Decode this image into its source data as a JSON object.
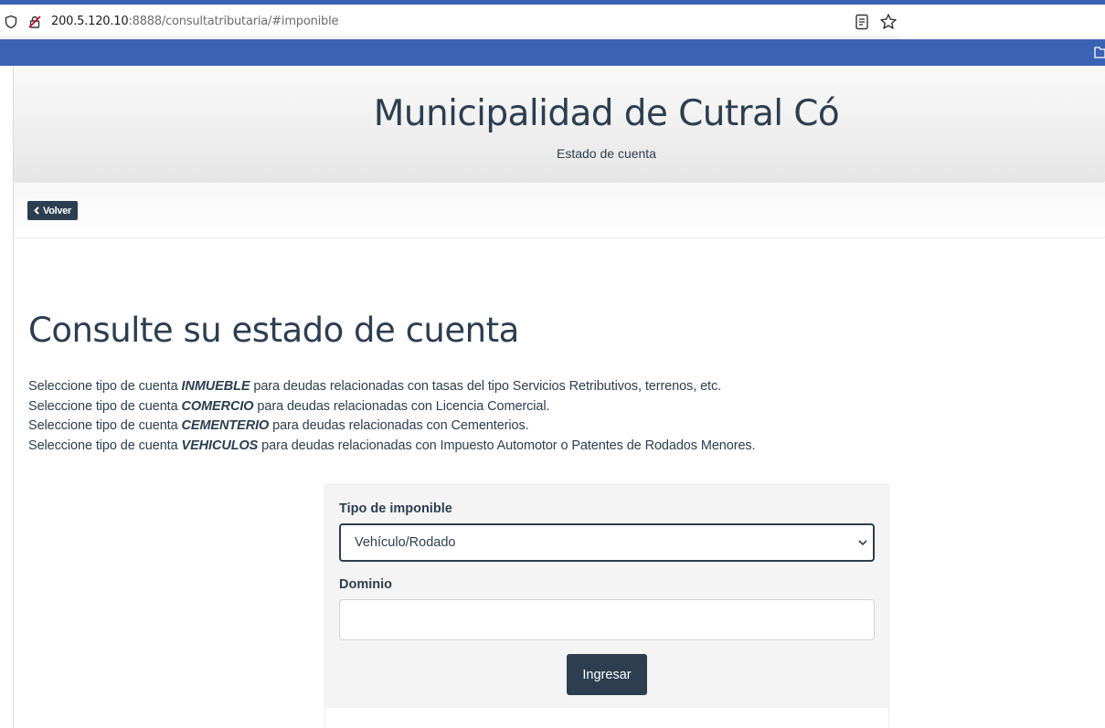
{
  "browser": {
    "url_host": "200.5.120.10",
    "url_rest": ":8888/consultatributaria/#imponible",
    "accent_color": "#3a63b4"
  },
  "header": {
    "title": "Municipalidad de Cutral Có",
    "subtitle": "Estado de cuenta"
  },
  "nav": {
    "back_label": "Volver"
  },
  "main": {
    "heading": "Consulte su estado de cuenta",
    "intro_prefix": "Seleccione tipo de cuenta",
    "lines": [
      {
        "type": "INMUEBLE",
        "desc": "para deudas relacionadas con tasas del tipo Servicios Retributivos, terrenos, etc."
      },
      {
        "type": "COMERCIO",
        "desc": "para deudas relacionadas con Licencia Comercial."
      },
      {
        "type": "CEMENTERIO",
        "desc": "para deudas relacionadas con Cementerios."
      },
      {
        "type": "VEHICULOS",
        "desc": "para deudas relacionadas con Impuesto Automotor o Patentes de Rodados Menores."
      }
    ]
  },
  "form": {
    "tipo_label": "Tipo de imponible",
    "tipo_value": "Vehículo/Rodado",
    "dominio_label": "Dominio",
    "dominio_value": "",
    "submit_label": "Ingresar",
    "theme_color": "#2c3e50"
  }
}
